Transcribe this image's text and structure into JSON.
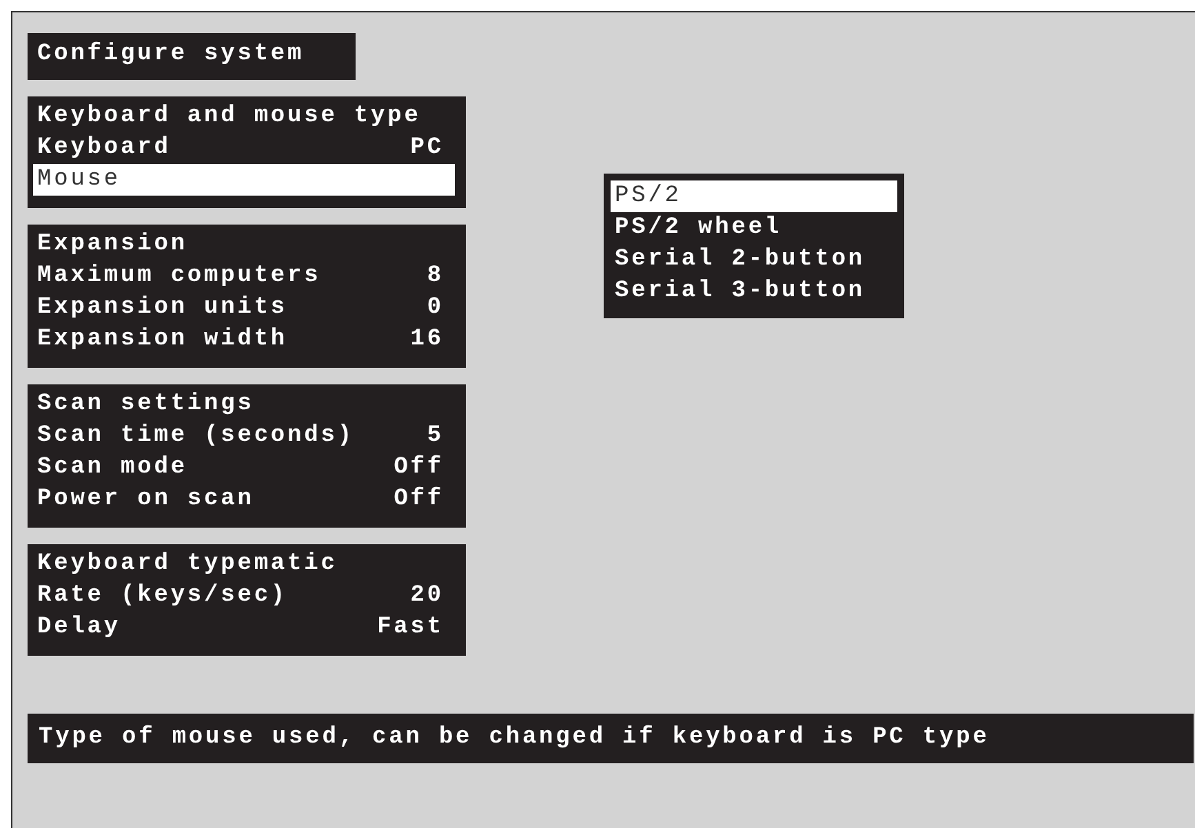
{
  "title": "Configure system",
  "panels": [
    {
      "heading": "Keyboard and mouse type",
      "rows": [
        {
          "label": "Keyboard",
          "value": "PC",
          "selected": false
        },
        {
          "label": "Mouse",
          "value": "",
          "selected": true
        }
      ]
    },
    {
      "heading": "Expansion",
      "rows": [
        {
          "label": "Maximum computers",
          "value": "8",
          "selected": false
        },
        {
          "label": "Expansion units",
          "value": "0",
          "selected": false
        },
        {
          "label": "Expansion width",
          "value": "16",
          "selected": false
        }
      ]
    },
    {
      "heading": "Scan settings",
      "rows": [
        {
          "label": "Scan time (seconds)",
          "value": "5",
          "selected": false
        },
        {
          "label": "Scan mode",
          "value": "Off",
          "selected": false
        },
        {
          "label": "Power on scan",
          "value": "Off",
          "selected": false
        }
      ]
    },
    {
      "heading": "Keyboard typematic",
      "rows": [
        {
          "label": "Rate (keys/sec)",
          "value": "20",
          "selected": false
        },
        {
          "label": "Delay",
          "value": "Fast",
          "selected": false
        }
      ]
    }
  ],
  "menu": {
    "options": [
      {
        "label": "PS/2",
        "selected": true
      },
      {
        "label": "PS/2 wheel",
        "selected": false
      },
      {
        "label": "Serial 2-button",
        "selected": false
      },
      {
        "label": "Serial 3-button",
        "selected": false
      }
    ]
  },
  "status_bar": "Type of mouse used, can be changed if keyboard is PC type"
}
